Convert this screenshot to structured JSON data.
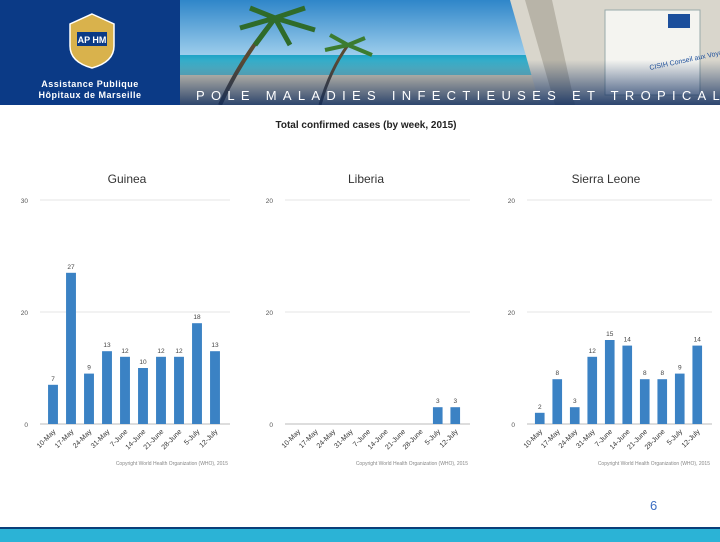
{
  "header": {
    "logo_text": "AP HM",
    "brand_line1": "Assistance Publique",
    "brand_line2": "Hôpitaux de Marseille",
    "banner": "POLE MALADIES INFECTIEUSES ET TROPICALES",
    "sign_text": "CISIH Conseil aux Voyageurs"
  },
  "main_title": "Total confirmed cases (by week, 2015)",
  "page_number": "6",
  "colors": {
    "bar": "#3b82c4",
    "header_bg": "#0d2b5e",
    "footer": "#2bb3d6"
  },
  "chart_data": [
    {
      "type": "bar",
      "title": "Guinea",
      "categories": [
        "10-May",
        "17-May",
        "24-May",
        "31-May",
        "7-June",
        "14-June",
        "21-June",
        "28-June",
        "5-July",
        "12-July"
      ],
      "values": [
        7,
        27,
        9,
        13,
        12,
        10,
        12,
        12,
        18,
        13
      ],
      "y_tick_labels": [
        "0",
        "20",
        "30"
      ],
      "ylim": [
        0,
        40
      ],
      "copyright": "Copyright World Health Organization (WHO), 2015"
    },
    {
      "type": "bar",
      "title": "Liberia",
      "categories": [
        "10-May",
        "17-May",
        "24-May",
        "31-May",
        "7-June",
        "14-June",
        "21-June",
        "28-June",
        "5-July",
        "12-July"
      ],
      "values": [
        0,
        0,
        0,
        0,
        0,
        0,
        0,
        0,
        3,
        3
      ],
      "y_tick_labels": [
        "0",
        "20",
        "20"
      ],
      "ylim": [
        0,
        40
      ],
      "copyright": "Copyright World Health Organization (WHO), 2015"
    },
    {
      "type": "bar",
      "title": "Sierra Leone",
      "categories": [
        "10-May",
        "17-May",
        "24-May",
        "31-May",
        "7-June",
        "14-June",
        "21-June",
        "28-June",
        "5-July",
        "12-July"
      ],
      "values": [
        2,
        8,
        3,
        12,
        15,
        14,
        8,
        8,
        9,
        14
      ],
      "y_tick_labels": [
        "0",
        "20",
        "20"
      ],
      "ylim": [
        0,
        40
      ],
      "copyright": "Copyright World Health Organization (WHO), 2015"
    }
  ]
}
